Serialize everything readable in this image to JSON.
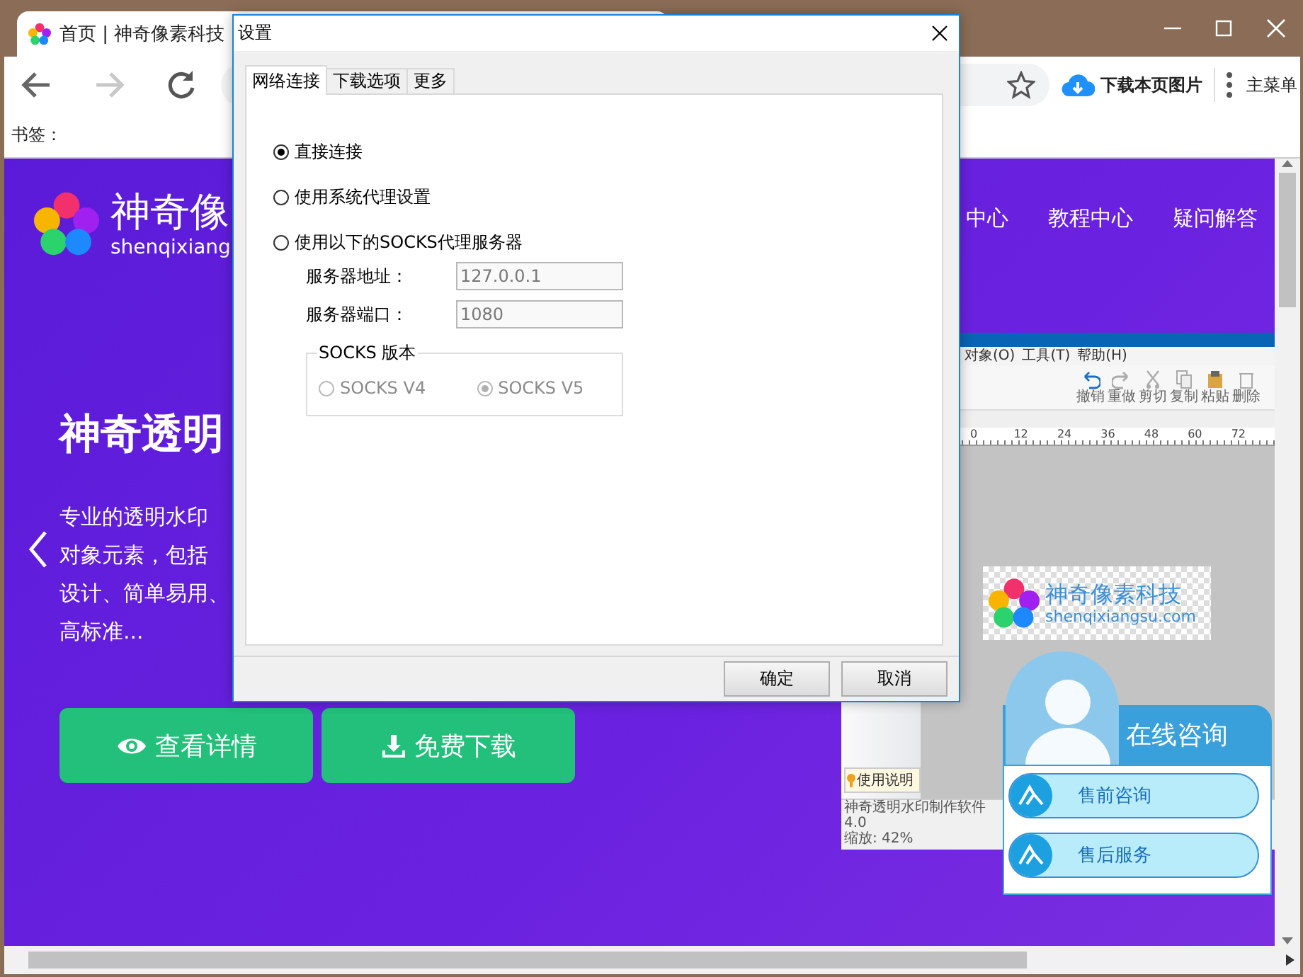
{
  "browser": {
    "tab": {
      "title": "首页 | 神奇像素科技"
    },
    "toolbar": {
      "download_button": "下载本页图片",
      "menu_button": "主菜单"
    },
    "bookmarks": {
      "label": "书签："
    }
  },
  "page": {
    "logo": {
      "name": "神奇像",
      "domain": "shenqixiang"
    },
    "nav": [
      "中心",
      "教程中心",
      "疑问解答"
    ],
    "hero": {
      "title": "神奇透明",
      "description_lines": [
        "专业的透明水印",
        "对象元素，包括",
        "设计、简单易用、",
        "高标准..."
      ],
      "buttons": [
        {
          "kind": "view",
          "label": "查看详情"
        },
        {
          "kind": "download",
          "label": "免费下载"
        }
      ]
    },
    "app_screenshot": {
      "menu": [
        "对象(O)",
        "工具(T)",
        "帮助(H)"
      ],
      "toolbar": [
        "撤销",
        "重做",
        "剪切",
        "复制",
        "粘贴",
        "删除"
      ],
      "ruler": [
        "0",
        "12",
        "24",
        "36",
        "48",
        "60",
        "72"
      ],
      "watermark": {
        "name": "神奇像素科技",
        "domain": "shenqixiangsu.com"
      },
      "help_button": "使用说明",
      "status": [
        "神奇透明水印制作软件 4.0",
        "缩放: 42%"
      ]
    },
    "chat_widget": {
      "title": "在线咨询",
      "items": [
        "售前咨询",
        "售后服务"
      ]
    }
  },
  "dialog": {
    "title": "设置",
    "tabs": [
      {
        "label": "网络连接",
        "selected": true
      },
      {
        "label": "下载选项",
        "selected": false
      },
      {
        "label": "更多",
        "selected": false
      }
    ],
    "connection_options": [
      {
        "label": "直接连接",
        "selected": true
      },
      {
        "label": "使用系统代理设置",
        "selected": false
      },
      {
        "label": "使用以下的SOCKS代理服务器",
        "selected": false
      }
    ],
    "fields": [
      {
        "label": "服务器地址：",
        "value": "127.0.0.1",
        "disabled": true
      },
      {
        "label": "服务器端口：",
        "value": "1080",
        "disabled": true
      }
    ],
    "socks_version": {
      "title": "SOCKS 版本",
      "options": [
        {
          "label": "SOCKS V4",
          "selected": false,
          "disabled": true
        },
        {
          "label": "SOCKS V5",
          "selected": true,
          "disabled": true
        }
      ]
    },
    "buttons": [
      "确定",
      "取消"
    ]
  }
}
